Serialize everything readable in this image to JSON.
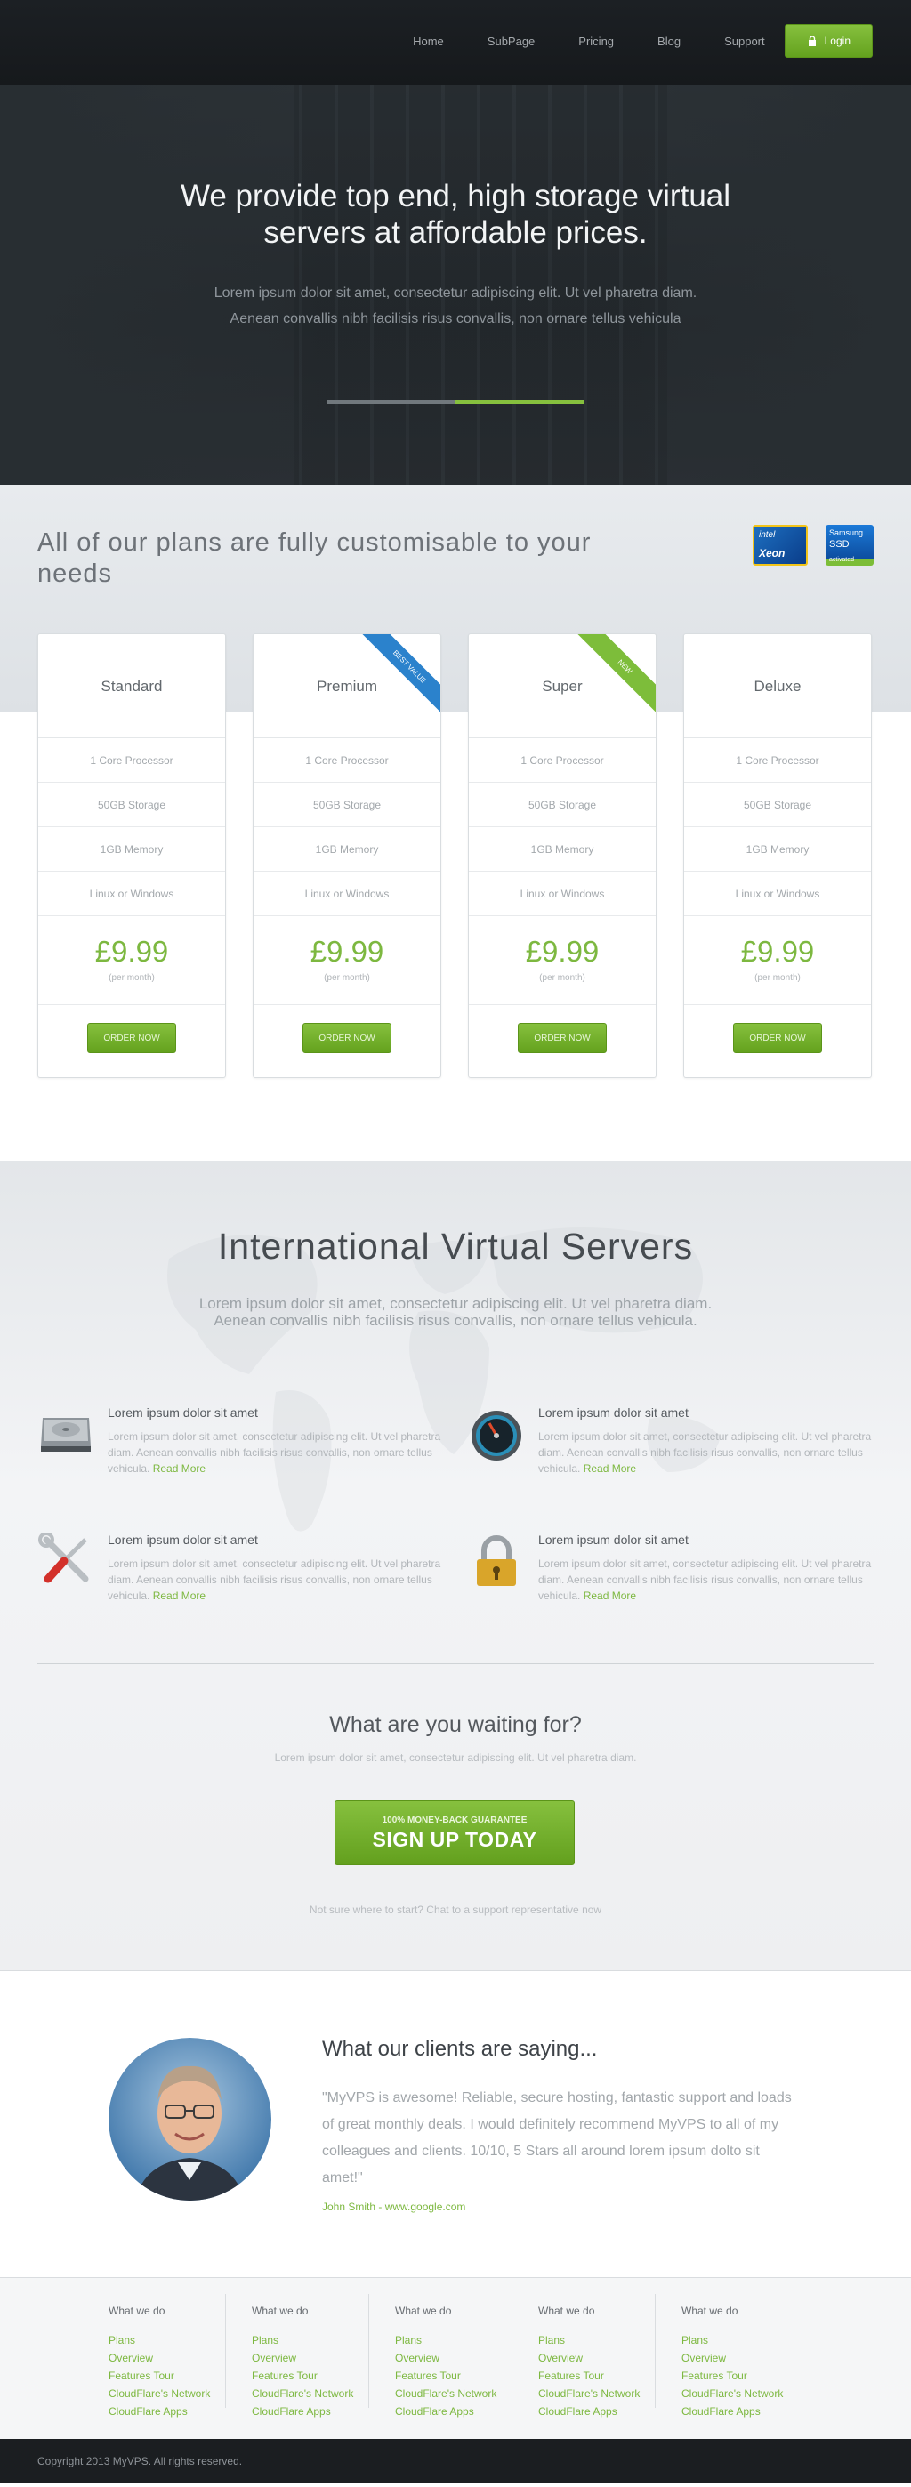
{
  "nav": {
    "links": [
      "Home",
      "SubPage",
      "Pricing",
      "Blog",
      "Support"
    ],
    "login_label": "Login"
  },
  "hero": {
    "title": "We provide top end, high storage virtual servers at affordable prices.",
    "text": "Lorem ipsum dolor sit amet, consectetur adipiscing elit. Ut vel pharetra diam. Aenean convallis nibh facilisis risus convallis, non ornare tellus vehicula",
    "slider_progress": 0.5
  },
  "plans": {
    "title": "All of our plans are fully customisable to your needs",
    "badges": {
      "intel_line1": "intel",
      "intel_line2": "Xeon",
      "ssd_line1": "Samsung",
      "ssd_line2": "SSD",
      "ssd_line3": "activated"
    },
    "items": [
      {
        "name": "Standard",
        "features": [
          "1 Core Processor",
          "50GB Storage",
          "1GB Memory",
          "Linux or Windows"
        ],
        "price": "£9.99",
        "period": "(per month)",
        "button": "ORDER NOW",
        "ribbon": ""
      },
      {
        "name": "Premium",
        "features": [
          "1 Core Processor",
          "50GB Storage",
          "1GB Memory",
          "Linux or Windows"
        ],
        "price": "£9.99",
        "period": "(per month)",
        "button": "ORDER NOW",
        "ribbon": "BEST VALUE"
      },
      {
        "name": "Super",
        "features": [
          "1 Core Processor",
          "50GB Storage",
          "1GB Memory",
          "Linux or Windows"
        ],
        "price": "£9.99",
        "period": "(per month)",
        "button": "ORDER NOW",
        "ribbon": "NEW"
      },
      {
        "name": "Deluxe",
        "features": [
          "1 Core Processor",
          "50GB Storage",
          "1GB Memory",
          "Linux or Windows"
        ],
        "price": "£9.99",
        "period": "(per month)",
        "button": "ORDER NOW",
        "ribbon": ""
      }
    ]
  },
  "international": {
    "title": "International Virtual Servers",
    "text": "Lorem ipsum dolor sit amet, consectetur adipiscing elit. Ut vel pharetra diam. Aenean convallis nibh facilisis risus convallis, non ornare tellus vehicula.",
    "features": [
      {
        "icon": "hard-drive-icon",
        "title": "Lorem ipsum dolor sit amet",
        "text": "Lorem ipsum dolor sit amet, consectetur adipiscing elit. Ut vel pharetra diam. Aenean convallis nibh facilisis risus convallis, non ornare tellus vehicula.",
        "link": "Read More"
      },
      {
        "icon": "speedometer-icon",
        "title": "Lorem ipsum dolor sit amet",
        "text": "Lorem ipsum dolor sit amet, consectetur adipiscing elit. Ut vel pharetra diam. Aenean convallis nibh facilisis risus convallis, non ornare tellus vehicula.",
        "link": "Read More"
      },
      {
        "icon": "tools-icon",
        "title": "Lorem ipsum dolor sit amet",
        "text": "Lorem ipsum dolor sit amet, consectetur adipiscing elit. Ut vel pharetra diam. Aenean convallis nibh facilisis risus convallis, non ornare tellus vehicula.",
        "link": "Read More"
      },
      {
        "icon": "padlock-icon",
        "title": "Lorem ipsum dolor sit amet",
        "text": "Lorem ipsum dolor sit amet, consectetur adipiscing elit. Ut vel pharetra diam. Aenean convallis nibh facilisis risus convallis, non ornare tellus vehicula.",
        "link": "Read More"
      }
    ]
  },
  "cta": {
    "title": "What are you waiting for?",
    "text": "Lorem ipsum dolor sit amet, consectetur adipiscing elit. Ut vel pharetra diam.",
    "button_small": "100% MONEY-BACK GUARANTEE",
    "button_big": "SIGN UP TODAY",
    "note": "Not sure where to start? Chat to a support representative now"
  },
  "testimonial": {
    "title": "What our clients are saying...",
    "quote": "\"MyVPS is awesome! Reliable, secure hosting, fantastic support and loads of great monthly deals. I would definitely recommend MyVPS to all of my colleagues and clients. 10/10, 5 Stars all around lorem ipsum dolto sit amet!\"",
    "author": "John Smith - www.google.com"
  },
  "footer": {
    "columns": [
      {
        "heading": "What we do",
        "links": [
          "Plans",
          "Overview",
          "Features Tour",
          "CloudFlare's Network",
          "CloudFlare Apps"
        ]
      },
      {
        "heading": "What we do",
        "links": [
          "Plans",
          "Overview",
          "Features Tour",
          "CloudFlare's Network",
          "CloudFlare Apps"
        ]
      },
      {
        "heading": "What we do",
        "links": [
          "Plans",
          "Overview",
          "Features Tour",
          "CloudFlare's Network",
          "CloudFlare Apps"
        ]
      },
      {
        "heading": "What we do",
        "links": [
          "Plans",
          "Overview",
          "Features Tour",
          "CloudFlare's Network",
          "CloudFlare Apps"
        ]
      },
      {
        "heading": "What we do",
        "links": [
          "Plans",
          "Overview",
          "Features Tour",
          "CloudFlare's Network",
          "CloudFlare Apps"
        ]
      }
    ],
    "copyright": "Copyright 2013 MyVPS. All rights reserved."
  },
  "colors": {
    "accent": "#7db840",
    "nav_bg": "#1b1e21",
    "ribbon_blue": "#2b82cc"
  }
}
